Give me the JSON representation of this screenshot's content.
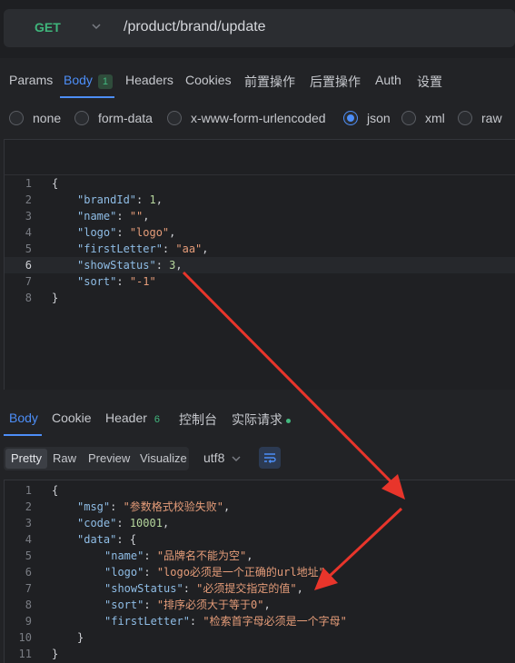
{
  "request": {
    "method": "GET",
    "url": "/product/brand/update"
  },
  "request_tabs": [
    {
      "label": "Params"
    },
    {
      "label": "Body",
      "badge": "1"
    },
    {
      "label": "Headers"
    },
    {
      "label": "Cookies"
    },
    {
      "label": "前置操作"
    },
    {
      "label": "后置操作"
    },
    {
      "label": "Auth"
    },
    {
      "label": "设置"
    }
  ],
  "body_types": [
    {
      "label": "none"
    },
    {
      "label": "form-data"
    },
    {
      "label": "x-www-form-urlencoded"
    },
    {
      "label": "json",
      "checked": true
    },
    {
      "label": "xml"
    },
    {
      "label": "raw"
    }
  ],
  "request_body": {
    "lines": [
      {
        "num": "1",
        "text": "{"
      },
      {
        "num": "2",
        "key": "\"brandId\"",
        "sep": ": ",
        "num_val": "1",
        "end": ","
      },
      {
        "num": "3",
        "key": "\"name\"",
        "sep": ": ",
        "str_val": "\"\"",
        "end": ","
      },
      {
        "num": "4",
        "key": "\"logo\"",
        "sep": ": ",
        "str_val": "\"logo\"",
        "end": ","
      },
      {
        "num": "5",
        "key": "\"firstLetter\"",
        "sep": ": ",
        "str_val": "\"aa\"",
        "end": ","
      },
      {
        "num": "6",
        "key": "\"showStatus\"",
        "sep": ": ",
        "num_val": "3",
        "end": ","
      },
      {
        "num": "7",
        "key": "\"sort\"",
        "sep": ": ",
        "str_val": "\"-1\"",
        "end": ""
      },
      {
        "num": "8",
        "text": "}"
      }
    ]
  },
  "response_tabs": [
    {
      "label": "Body"
    },
    {
      "label": "Cookie"
    },
    {
      "label": "Header",
      "badge": "6"
    },
    {
      "label": "控制台"
    },
    {
      "label": "实际请求"
    }
  ],
  "view_modes": [
    "Pretty",
    "Raw",
    "Preview",
    "Visualize"
  ],
  "encoding": "utf8",
  "response_body": {
    "lines": [
      {
        "num": "1",
        "text": "{"
      },
      {
        "num": "2",
        "key": "\"msg\"",
        "sep": ": ",
        "str_val": "\"参数格式校验失败\"",
        "end": ","
      },
      {
        "num": "3",
        "key": "\"code\"",
        "sep": ": ",
        "num_val": "10001",
        "end": ","
      },
      {
        "num": "4",
        "key": "\"data\"",
        "sep": ": ",
        "text_after": "{"
      },
      {
        "num": "5",
        "key": "\"name\"",
        "sep": ": ",
        "str_val": "\"品牌名不能为空\"",
        "end": ","
      },
      {
        "num": "6",
        "key": "\"logo\"",
        "sep": ": ",
        "str_val": "\"logo必须是一个正确的url地址\"",
        "end": ","
      },
      {
        "num": "7",
        "key": "\"showStatus\"",
        "sep": ": ",
        "str_val": "\"必须提交指定的值\"",
        "end": ","
      },
      {
        "num": "8",
        "key": "\"sort\"",
        "sep": ": ",
        "str_val": "\"排序必须大于等于0\"",
        "end": ","
      },
      {
        "num": "9",
        "key": "\"firstLetter\"",
        "sep": ": ",
        "str_val": "\"检索首字母必须是一个字母\"",
        "end": ""
      },
      {
        "num": "10",
        "text": "}"
      },
      {
        "num": "11",
        "text": "}"
      }
    ]
  },
  "colors": {
    "accent": "#4d8ef7",
    "method": "#3fb57b",
    "annotation_arrow": "#e8352b"
  }
}
